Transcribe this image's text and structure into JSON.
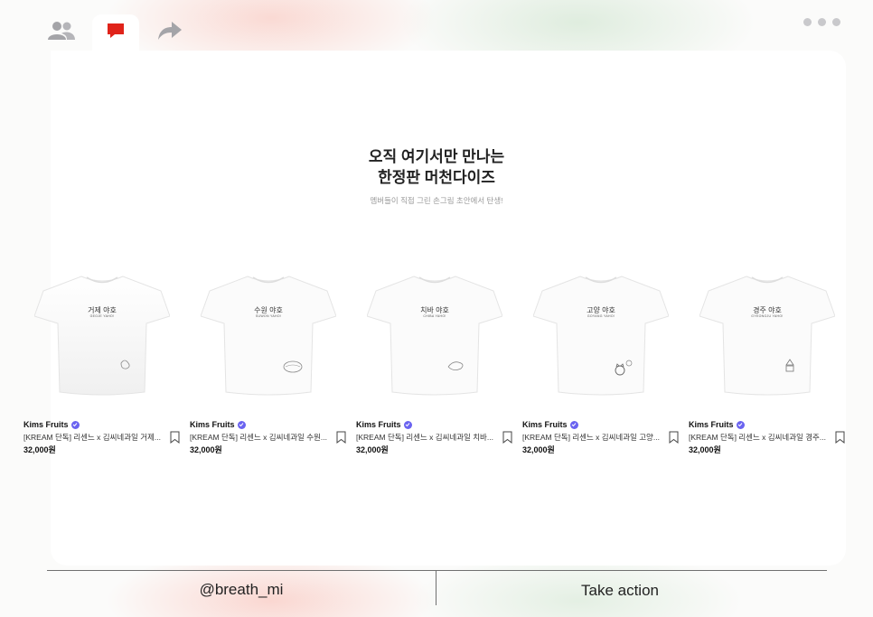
{
  "toolbar": {
    "icons": [
      "people-icon",
      "comment-icon",
      "share-icon"
    ],
    "active_tab": "comment-icon",
    "more_icon": "more-dots-icon",
    "active_color": "#e0231a",
    "inactive_color": "#a4a4a8"
  },
  "hero": {
    "headline_line1": "오직 여기서만 만나는",
    "headline_line2": "한정판 머천다이즈",
    "subtitle": "멤버들이 직접 그린 손그림 초안에서 탄생!"
  },
  "products": [
    {
      "shirt_text_ko": "거제 야호",
      "shirt_text_en": "GEOJE YAHO!",
      "brand": "Kims Fruits",
      "title": "[KREAM 단독] 리센느 x 김씨네과일 거제...",
      "price": "32,000원"
    },
    {
      "shirt_text_ko": "수원 야호",
      "shirt_text_en": "SUWON YAHO!",
      "brand": "Kims Fruits",
      "title": "[KREAM 단독] 리센느 x 김씨네과일 수원...",
      "price": "32,000원"
    },
    {
      "shirt_text_ko": "치바 야호",
      "shirt_text_en": "CHIBA YAHO!",
      "brand": "Kims Fruits",
      "title": "[KREAM 단독] 리센느 x 김씨네과일 치바...",
      "price": "32,000원"
    },
    {
      "shirt_text_ko": "고양 야호",
      "shirt_text_en": "GOYANG YAHO!",
      "brand": "Kims Fruits",
      "title": "[KREAM 단독] 리센느 x 김씨네과일 고양...",
      "price": "32,000원"
    },
    {
      "shirt_text_ko": "경주 야호",
      "shirt_text_en": "GYEONGJU YAHO!",
      "brand": "Kims Fruits",
      "title": "[KREAM 단독] 리센느 x 김씨네과일 경주...",
      "price": "32,000원"
    }
  ],
  "footer": {
    "handle": "@breath_mi",
    "action": "Take action"
  }
}
